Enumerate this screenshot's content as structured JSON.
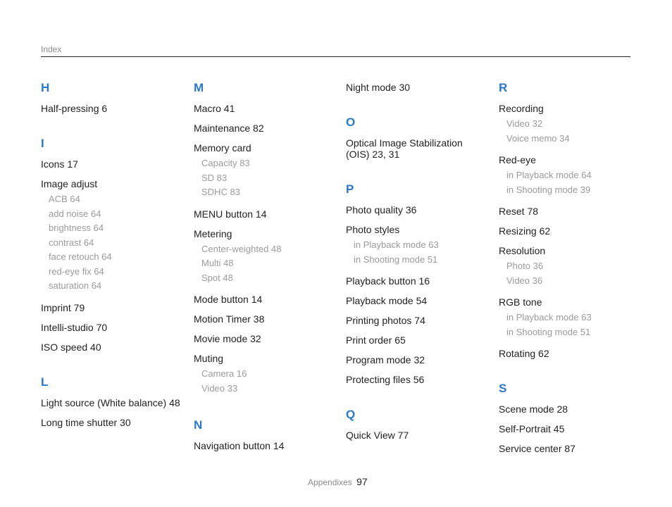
{
  "header": {
    "label": "Index"
  },
  "columns": [
    [
      {
        "letter": "H"
      },
      {
        "text": "Half-pressing  6"
      },
      {
        "spacer": true
      },
      {
        "letter": "I"
      },
      {
        "text": "Icons  17"
      },
      {
        "text": "Image adjust",
        "subs": [
          "ACB  64",
          "add noise  64",
          "brightness  64",
          "contrast  64",
          "face retouch  64",
          "red-eye fix  64",
          "saturation  64"
        ]
      },
      {
        "text": "Imprint  79"
      },
      {
        "text": "Intelli-studio  70"
      },
      {
        "text": "ISO speed  40"
      },
      {
        "spacer": true
      },
      {
        "letter": "L"
      },
      {
        "text": "Light source (White balance) 48"
      },
      {
        "text": "Long time shutter  30"
      }
    ],
    [
      {
        "letter": "M"
      },
      {
        "text": "Macro  41"
      },
      {
        "text": "Maintenance  82"
      },
      {
        "text": "Memory card",
        "subs": [
          "Capacity  83",
          "SD  83",
          "SDHC  83"
        ]
      },
      {
        "text": "MENU button  14"
      },
      {
        "text": "Metering",
        "subs": [
          "Center-weighted  48",
          "Multi  48",
          "Spot  48"
        ]
      },
      {
        "text": "Mode button  14"
      },
      {
        "text": "Motion Timer  38"
      },
      {
        "text": "Movie mode  32"
      },
      {
        "text": "Muting",
        "subs": [
          "Camera  16",
          "Video  33"
        ]
      },
      {
        "spacer": true
      },
      {
        "letter": "N"
      },
      {
        "text": "Navigation button  14"
      }
    ],
    [
      {
        "text": "Night mode  30"
      },
      {
        "spacer": true
      },
      {
        "letter": "O"
      },
      {
        "text": "Optical Image Stabilization (OIS)  23, 31"
      },
      {
        "spacer": true
      },
      {
        "letter": "P"
      },
      {
        "text": "Photo quality  36"
      },
      {
        "text": "Photo styles",
        "subs": [
          "in Playback mode  63",
          "in Shooting mode  51"
        ]
      },
      {
        "text": "Playback button  16"
      },
      {
        "text": "Playback mode  54"
      },
      {
        "text": "Printing photos  74"
      },
      {
        "text": "Print order  65"
      },
      {
        "text": "Program mode  32"
      },
      {
        "text": "Protecting files  56"
      },
      {
        "spacer": true
      },
      {
        "letter": "Q"
      },
      {
        "text": "Quick View  77"
      }
    ],
    [
      {
        "letter": "R"
      },
      {
        "text": "Recording",
        "subs": [
          "Video  32",
          "Voice memo  34"
        ]
      },
      {
        "text": "Red-eye",
        "subs": [
          "in Playback mode  64",
          "in Shooting mode  39"
        ]
      },
      {
        "text": "Reset  78"
      },
      {
        "text": "Resizing  62"
      },
      {
        "text": "Resolution",
        "subs": [
          "Photo  36",
          "Video  36"
        ]
      },
      {
        "text": "RGB tone",
        "subs": [
          "in Playback mode  63",
          "in Shooting mode  51"
        ]
      },
      {
        "text": "Rotating  62"
      },
      {
        "spacer": true
      },
      {
        "letter": "S"
      },
      {
        "text": "Scene mode  28"
      },
      {
        "text": "Self-Portrait  45"
      },
      {
        "text": "Service center  87"
      }
    ]
  ],
  "footer": {
    "section": "Appendixes",
    "page": "97"
  }
}
